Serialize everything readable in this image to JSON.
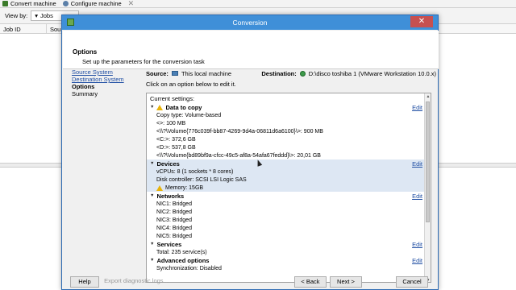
{
  "background": {
    "toolbar": [
      {
        "label": "Convert machine",
        "icon": "convert-icon"
      },
      {
        "label": "Configure machine",
        "icon": "gear-icon"
      }
    ],
    "view_by_label": "View by:",
    "view_by_value": "Jobs",
    "columns": [
      "Job ID",
      "Sou"
    ]
  },
  "dialog": {
    "title": "Conversion",
    "header_title": "Options",
    "header_subtitle": "Set up the parameters for the conversion task",
    "steps": [
      {
        "label": "Source System"
      },
      {
        "label": "Destination System"
      },
      {
        "label": "Options"
      },
      {
        "label": "Summary"
      }
    ],
    "source_label": "Source:",
    "source_value": "This local machine",
    "destination_label": "Destination:",
    "destination_value": "D:\\disco toshiba 1 (VMware Workstation 10.0.x)",
    "hint": "Click on an option below to edit it.",
    "current_settings": "Current settings:",
    "edit_label": "Edit",
    "sections": [
      {
        "title": "Data to copy",
        "warning": true,
        "items": [
          "Copy type: Volume-based",
          "<>: 100 MB",
          "<\\\\?\\Volume{776c039f-bb87-4269-9d4a-06811d6a6100}\\>: 900 MB",
          "<C:>: 372,6 GB",
          "<D:>: 537,8 GB",
          "<\\\\?\\Volume{bd89bf9a-cfcc-49c5-af8a-54afa67feddd}\\>: 20,01 GB"
        ]
      },
      {
        "title": "Devices",
        "warning": false,
        "items": [
          "vCPUs: 8 (1 sockets * 8 cores)",
          "Disk controller: SCSI LSI Logic SAS",
          "Memory: 15GB"
        ]
      },
      {
        "title": "Networks",
        "warning": false,
        "items": [
          "NIC1: Bridged",
          "NIC2: Bridged",
          "NIC3: Bridged",
          "NIC4: Bridged",
          "NIC5: Bridged"
        ]
      },
      {
        "title": "Services",
        "warning": false,
        "items": [
          "Total: 235 service(s)"
        ]
      },
      {
        "title": "Advanced options",
        "warning": false,
        "items": [
          "Synchronization: Disabled"
        ]
      }
    ],
    "buttons": {
      "help": "Help",
      "export": "Export diagnostic logs...",
      "back": "< Back",
      "next": "Next >",
      "cancel": "Cancel"
    }
  }
}
